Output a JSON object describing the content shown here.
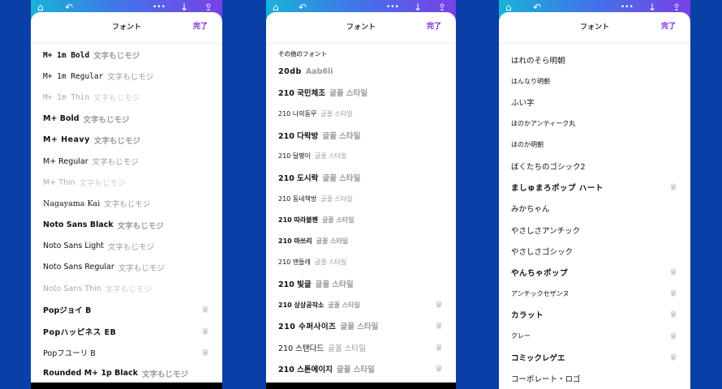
{
  "topbar_icons": [
    "home-icon",
    "undo-icon",
    "more-icon",
    "download-icon",
    "share-icon"
  ],
  "topbar_glyphs": {
    "home": "⌂",
    "undo": "↶",
    "more": "•••",
    "download": "↓",
    "share": "⇪"
  },
  "panels": [
    {
      "title": "フォント",
      "done_label": "完了",
      "items": [
        {
          "name": "M+ 1m Bold",
          "sample": "文字もじモジ",
          "style": "mono"
        },
        {
          "name": "M+ 1m Regular",
          "sample": "文字もじモジ",
          "style": "mono reg"
        },
        {
          "name": "M+ 1m Thin",
          "sample": "文字もじモジ",
          "style": "mono light"
        },
        {
          "name": "M+ Bold",
          "sample": "文字もじモジ",
          "style": ""
        },
        {
          "name": "M+ Heavy",
          "sample": "文字もじモジ",
          "style": "heavy"
        },
        {
          "name": "M+ Regular",
          "sample": "文字もじモジ",
          "style": "reg"
        },
        {
          "name": "M+ Thin",
          "sample": "文字もじモジ",
          "style": "light"
        },
        {
          "name": "Nagayama Kai",
          "sample": "文字もじモジ",
          "style": "serif reg"
        },
        {
          "name": "Noto Sans Black",
          "sample": "文字もじモジ",
          "style": ""
        },
        {
          "name": "Noto Sans Light",
          "sample": "文字もじモジ",
          "style": "reg"
        },
        {
          "name": "Noto Sans Regular",
          "sample": "文字もじモジ",
          "style": "reg"
        },
        {
          "name": "Noto Sans Thin",
          "sample": "文字もじモジ",
          "style": "light"
        },
        {
          "name": "Popジョイ B",
          "sample": "",
          "style": "",
          "premium": true
        },
        {
          "name": "Popハッピネス EB",
          "sample": "",
          "style": "heavy",
          "premium": true
        },
        {
          "name": "Popフユーリ B",
          "sample": "",
          "style": "reg",
          "premium": true
        },
        {
          "name": "Rounded M+ 1p Black",
          "sample": "文字もじモジ",
          "style": ""
        }
      ]
    },
    {
      "title": "フォント",
      "done_label": "完了",
      "section": "その他のフォント",
      "items": [
        {
          "name": "20db",
          "sample": "Aab6li",
          "style": "heavy"
        },
        {
          "name": "210 국민체조",
          "sample": "글꼴 스타일",
          "style": ""
        },
        {
          "name": "210 나의동무",
          "sample": "글꼴 스타일",
          "style": "reg small"
        },
        {
          "name": "210 다락방",
          "sample": "글꼴 스타일",
          "style": ""
        },
        {
          "name": "210 달팽이",
          "sample": "글꼴 스타일",
          "style": "reg small"
        },
        {
          "name": "210 도시락",
          "sample": "글꼴 스타일",
          "style": ""
        },
        {
          "name": "210 동네책방",
          "sample": "글꼴 스타일",
          "style": "reg small"
        },
        {
          "name": "210 따라볼펜",
          "sample": "글꼴 스타일",
          "style": "small"
        },
        {
          "name": "210 마쓰리",
          "sample": "글꼴 스타일",
          "style": "small"
        },
        {
          "name": "210 맨들레",
          "sample": "글꼴 스타일",
          "style": "reg small"
        },
        {
          "name": "210 빛글",
          "sample": "글꼴 스타일",
          "style": ""
        },
        {
          "name": "210 상상공작소",
          "sample": "글꼴 스타일",
          "style": "small",
          "premium": true
        },
        {
          "name": "210 수퍼사이즈",
          "sample": "글꼴 스타일",
          "style": "heavy",
          "premium": true
        },
        {
          "name": "210 스탠다드",
          "sample": "글꼴 스타일",
          "style": "reg",
          "premium": true
        },
        {
          "name": "210 스톤에이지",
          "sample": "글꼴 스타일",
          "style": "",
          "premium": true
        }
      ]
    },
    {
      "title": "フォント",
      "done_label": "完了",
      "items": [
        {
          "name": "はれのそら明朝",
          "style": "serif"
        },
        {
          "name": "はんなり明朝",
          "style": "serif small"
        },
        {
          "name": "ふい字",
          "style": "serif"
        },
        {
          "name": "ほのかアンティーク丸",
          "style": "reg small"
        },
        {
          "name": "ほのか明朝",
          "style": "serif small"
        },
        {
          "name": "ぼくたちのゴシック2",
          "style": "reg"
        },
        {
          "name": "ましゅまろポップ ハート",
          "style": "heavy",
          "premium": true
        },
        {
          "name": "みかちゃん",
          "style": "reg"
        },
        {
          "name": "やさしさアンチック",
          "style": "reg"
        },
        {
          "name": "やさしさゴシック",
          "style": "reg"
        },
        {
          "name": "やんちゃポップ",
          "style": "heavy",
          "premium": true
        },
        {
          "name": "アンチックセザンヌ",
          "style": "serif small",
          "premium": true
        },
        {
          "name": "カラット",
          "style": "heavy",
          "premium": true
        },
        {
          "name": "クレー",
          "style": "reg small",
          "premium": true
        },
        {
          "name": "コミックレゲエ",
          "style": "",
          "premium": true
        },
        {
          "name": "コーポレート・ロゴ",
          "style": "reg"
        }
      ]
    }
  ],
  "crown_glyph": "♛"
}
